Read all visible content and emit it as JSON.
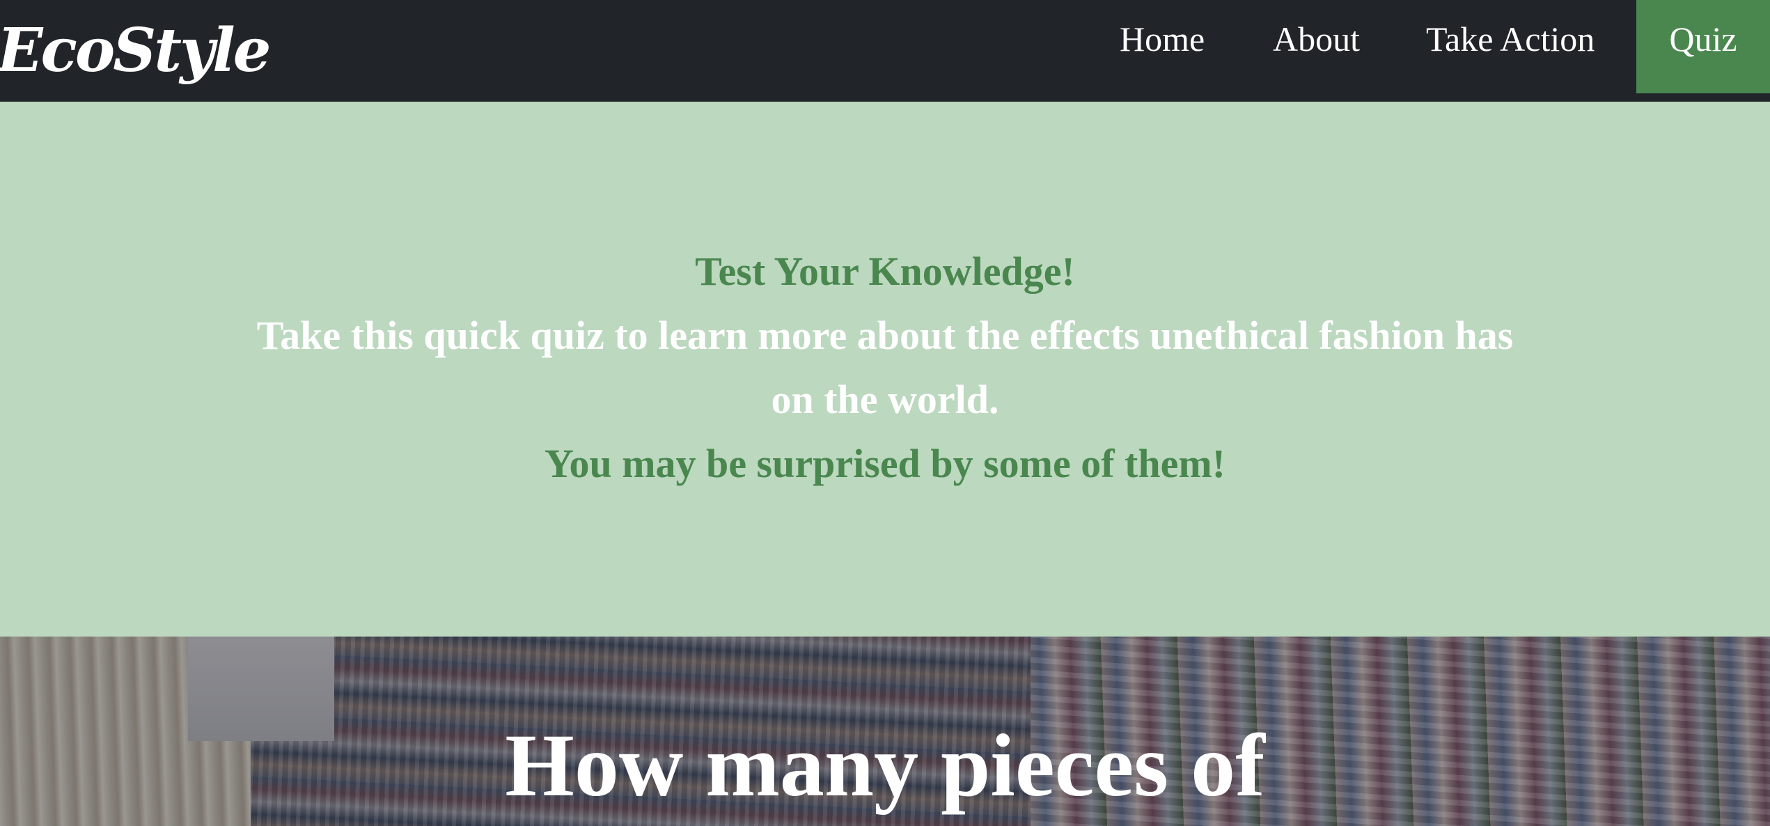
{
  "brand": {
    "logo_text": "EcoStyle"
  },
  "nav": {
    "items": [
      {
        "label": "Home"
      },
      {
        "label": "About"
      },
      {
        "label": "Take Action"
      },
      {
        "label": "Quiz",
        "active": true
      }
    ]
  },
  "intro": {
    "title": "Test Your Knowledge!",
    "body_line1": "Take this quick quiz to learn more about the effects unethical fashion has",
    "body_line2": "on the world.",
    "note": "You may be surprised by some of them!"
  },
  "question": {
    "text": "How many pieces of"
  },
  "colors": {
    "nav_bg": "#212529",
    "accent_green": "#4a874f",
    "section_bg": "#bcd8bf",
    "text_light": "#ffffff"
  }
}
